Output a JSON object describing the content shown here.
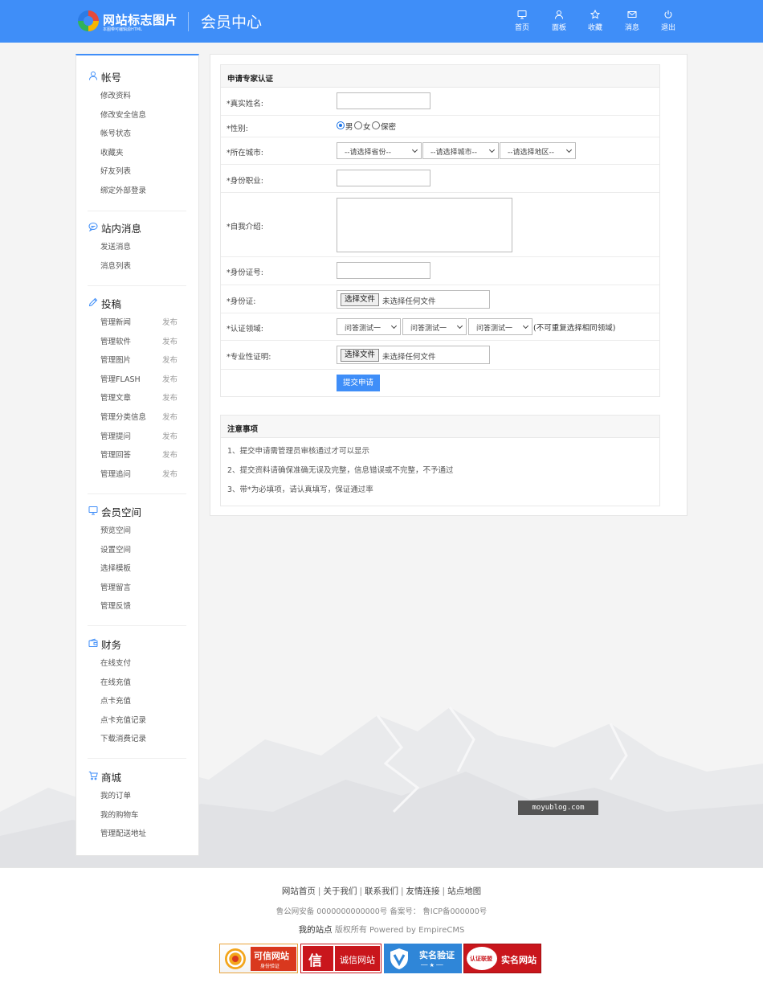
{
  "header": {
    "logo_name": "网站标志图片",
    "logo_sub": "本图带可编辑源HTML",
    "title": "会员中心",
    "nav": [
      {
        "label": "首页",
        "icon": "monitor-icon"
      },
      {
        "label": "面板",
        "icon": "user-icon"
      },
      {
        "label": "收藏",
        "icon": "star-icon"
      },
      {
        "label": "消息",
        "icon": "mail-icon"
      },
      {
        "label": "退出",
        "icon": "power-icon"
      }
    ]
  },
  "sidebar": {
    "groups": [
      {
        "title": "帐号",
        "icon": "user-icon",
        "items": [
          {
            "label": "修改资料"
          },
          {
            "label": "修改安全信息"
          },
          {
            "label": "帐号状态"
          },
          {
            "label": "收藏夹"
          },
          {
            "label": "好友列表"
          },
          {
            "label": "绑定外部登录"
          }
        ]
      },
      {
        "title": "站内消息",
        "icon": "chat-icon",
        "items": [
          {
            "label": "发送消息"
          },
          {
            "label": "消息列表"
          }
        ]
      },
      {
        "title": "投稿",
        "icon": "pencil-icon",
        "items": [
          {
            "label": "管理新闻",
            "action": "发布"
          },
          {
            "label": "管理软件",
            "action": "发布"
          },
          {
            "label": "管理图片",
            "action": "发布"
          },
          {
            "label": "管理FLASH",
            "action": "发布"
          },
          {
            "label": "管理文章",
            "action": "发布"
          },
          {
            "label": "管理分类信息",
            "action": "发布"
          },
          {
            "label": "管理提问",
            "action": "发布"
          },
          {
            "label": "管理回答",
            "action": "发布"
          },
          {
            "label": "管理追问",
            "action": "发布"
          }
        ]
      },
      {
        "title": "会员空间",
        "icon": "monitor-icon",
        "items": [
          {
            "label": "预览空间"
          },
          {
            "label": "设置空间"
          },
          {
            "label": "选择模板"
          },
          {
            "label": "管理留言"
          },
          {
            "label": "管理反馈"
          }
        ]
      },
      {
        "title": "财务",
        "icon": "wallet-icon",
        "items": [
          {
            "label": "在线支付"
          },
          {
            "label": "在线充值"
          },
          {
            "label": "点卡充值"
          },
          {
            "label": "点卡充值记录"
          },
          {
            "label": "下载消费记录"
          }
        ]
      },
      {
        "title": "商城",
        "icon": "cart-icon",
        "items": [
          {
            "label": "我的订单"
          },
          {
            "label": "我的购物车"
          },
          {
            "label": "管理配送地址"
          }
        ]
      }
    ]
  },
  "form": {
    "title": "申请专家认证",
    "name_label": "*真实姓名:",
    "gender_label": "*性别:",
    "gender_options": [
      "男",
      "女",
      "保密"
    ],
    "city_label": "*所在城市:",
    "province_select": "--请选择省份--",
    "city_select": "--请选择城市--",
    "district_select": "--请选择地区--",
    "job_label": "*身份职业:",
    "intro_label": "*自我介绍:",
    "id_label": "*身份证号:",
    "idcard_label": "*身份证:",
    "file_button": "选择文件",
    "file_none": "未选择任何文件",
    "field_label": "*认证领域:",
    "field_select": "问答测试一",
    "field_note": "(不可重复选择相同领域)",
    "cert_label": "*专业性证明:",
    "submit": "提交申请"
  },
  "notice": {
    "title": "注意事项",
    "lines": [
      "1、提交申请需管理员审核通过才可以显示",
      "2、提交资料请确保准确无误及完整，信息错误或不完整，不予通过",
      "3、带*为必填项，请认真填写，保证通过率"
    ]
  },
  "watermark": "moyublog.com",
  "footer": {
    "links": [
      "网站首页",
      "关于我们",
      "联系我们",
      "友情连接",
      "站点地图"
    ],
    "beian": "鲁公网安备 0000000000000号 备案号：  鲁ICP备000000号",
    "site_name": "我的站点",
    "copyright": "版权所有 Powered by EmpireCMS",
    "badges": [
      {
        "title": "可信网站",
        "sub": "身份验证"
      },
      {
        "title": "诚信网站",
        "sub": ""
      },
      {
        "title": "实名验证",
        "sub": ""
      },
      {
        "title": "实名网站",
        "sub": "认证联盟"
      }
    ]
  },
  "colors": {
    "primary": "#3f8ef8",
    "background": "#f4f4f4"
  }
}
